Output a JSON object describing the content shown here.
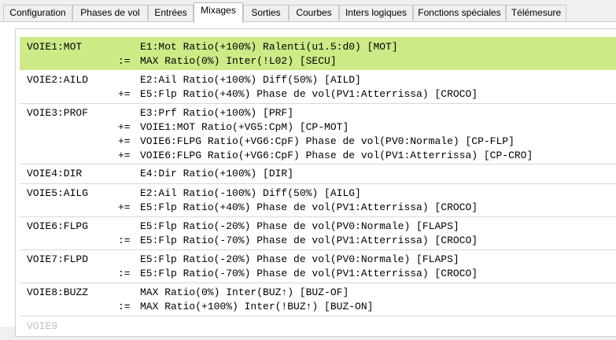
{
  "tabs": [
    {
      "label": "Configuration",
      "active": false
    },
    {
      "label": "Phases de vol",
      "active": false
    },
    {
      "label": "Entrées",
      "active": false
    },
    {
      "label": "Mixages",
      "active": true
    },
    {
      "label": "Sorties",
      "active": false
    },
    {
      "label": "Courbes",
      "active": false
    },
    {
      "label": "Inters logiques",
      "active": false
    },
    {
      "label": "Fonctions spéciales",
      "active": false
    },
    {
      "label": "Télémesure",
      "active": false
    }
  ],
  "selection_color": "#cdea87",
  "mixes": [
    {
      "channel": "VOIE1:MOT",
      "lines": [
        {
          "op": "",
          "text": "E1:Mot Ratio(+100%) Ralenti(u1.5:d0) [MOT]"
        },
        {
          "op": ":=",
          "text": "MAX Ratio(0%) Inter(!L02) [SECU]"
        }
      ]
    },
    {
      "channel": "VOIE2:AILD",
      "lines": [
        {
          "op": "",
          "text": "E2:Ail Ratio(+100%) Diff(50%) [AILD]"
        },
        {
          "op": "+=",
          "text": "E5:Flp Ratio(+40%) Phase de vol(PV1:Atterrissa) [CROCO]"
        }
      ]
    },
    {
      "channel": "VOIE3:PROF",
      "lines": [
        {
          "op": "",
          "text": "E3:Prf Ratio(+100%) [PRF]"
        },
        {
          "op": "+=",
          "text": "VOIE1:MOT Ratio(+VG5:CpM) [CP-MOT]"
        },
        {
          "op": "+=",
          "text": "VOIE6:FLPG Ratio(+VG6:CpF) Phase de vol(PV0:Normale) [CP-FLP]"
        },
        {
          "op": "+=",
          "text": "VOIE6:FLPG Ratio(+VG6:CpF) Phase de vol(PV1:Atterrissa) [CP-CRO]"
        }
      ]
    },
    {
      "channel": "VOIE4:DIR",
      "lines": [
        {
          "op": "",
          "text": "E4:Dir Ratio(+100%) [DIR]"
        }
      ]
    },
    {
      "channel": "VOIE5:AILG",
      "lines": [
        {
          "op": "",
          "text": "E2:Ail Ratio(-100%) Diff(50%) [AILG]"
        },
        {
          "op": "+=",
          "text": "E5:Flp Ratio(+40%) Phase de vol(PV1:Atterrissa) [CROCO]"
        }
      ]
    },
    {
      "channel": "VOIE6:FLPG",
      "lines": [
        {
          "op": "",
          "text": "E5:Flp Ratio(-20%) Phase de vol(PV0:Normale) [FLAPS]"
        },
        {
          "op": ":=",
          "text": "E5:Flp Ratio(-70%) Phase de vol(PV1:Atterrissa) [CROCO]"
        }
      ]
    },
    {
      "channel": "VOIE7:FLPD",
      "lines": [
        {
          "op": "",
          "text": "E5:Flp Ratio(-20%) Phase de vol(PV0:Normale) [FLAPS]"
        },
        {
          "op": ":=",
          "text": "E5:Flp Ratio(-70%) Phase de vol(PV1:Atterrissa) [CROCO]"
        }
      ]
    },
    {
      "channel": "VOIE8:BUZZ",
      "lines": [
        {
          "op": "",
          "text": "MAX Ratio(0%) Inter(BUZ↑) [BUZ-OF]"
        },
        {
          "op": ":=",
          "text": "MAX Ratio(+100%) Inter(!BUZ↑) [BUZ-ON]"
        }
      ]
    },
    {
      "channel": "VOIE9",
      "lines": []
    }
  ]
}
